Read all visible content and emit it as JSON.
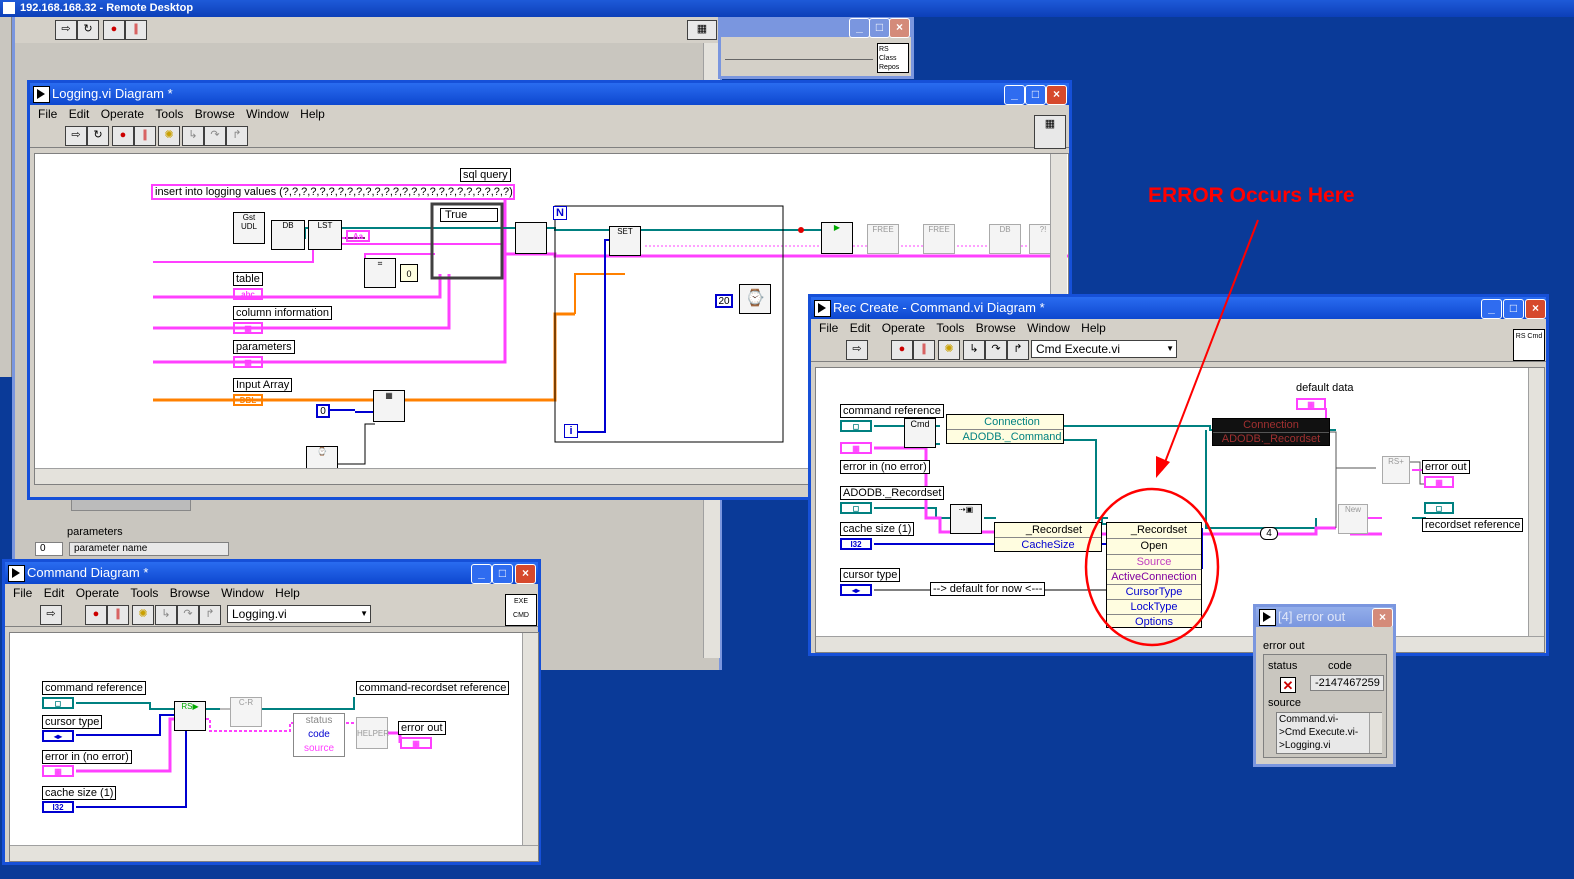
{
  "remote_title": "192.168.168.32 - Remote Desktop",
  "icons": {
    "vi": "labview-vi-icon",
    "minimize": "minimize-icon",
    "maximize": "maximize-icon",
    "close": "close-icon"
  },
  "colors": {
    "desktop": "#0a3a98",
    "titlebar": "#0d47cf",
    "wire_pink": "#ff40ff",
    "wire_blue": "#0000d0",
    "wire_orange": "#ff8000",
    "wire_teal": "#008080",
    "annotation": "#ff0000"
  },
  "menu": [
    "File",
    "Edit",
    "Operate",
    "Tools",
    "Browse",
    "Window",
    "Help"
  ],
  "bg_window": {
    "label1": "RS Class Repos"
  },
  "logging": {
    "title": "Logging.vi Diagram *",
    "sql_label": "sql query",
    "sql_value": "insert into logging values (?,?,?,?,?,?,?,?,?,?,?,?,?,?,?,?,?,?,?,?,?,?,?,?,?)",
    "case_value": "True",
    "table": "table",
    "column_info": "column information",
    "parameters": "parameters",
    "input_array": "Input Array",
    "const_zero": "0",
    "const_twenty": "20",
    "loop_n": "N",
    "loop_i": "i",
    "gst_udl": "Gst UDL",
    "lst": "LST",
    "abc": "abc",
    "dbl": "DBL",
    "db": "DB"
  },
  "behind_panel": {
    "parameters": "parameters",
    "parameter_name": "parameter name",
    "index": "0"
  },
  "command": {
    "title": "Command Diagram *",
    "vi_select": "Logging.vi",
    "cmd_ref": "command reference",
    "cursor_type": "cursor type",
    "error_in": "error in (no error)",
    "cache_size": "cache size (1)",
    "recordset_ref": "command-recordset reference",
    "error_out": "error out",
    "status": "status",
    "code": "code",
    "source": "source",
    "helper": "HELPER",
    "i32": "I32",
    "exe": "EXE",
    "cmd": "CMD"
  },
  "rec": {
    "title": "Rec Create - Command.vi Diagram *",
    "vi_select": "Cmd Execute.vi",
    "cmd_ref": "command reference",
    "error_in": "error in (no error)",
    "adodb_recordset": "ADODB._Recordset",
    "cache_size": "cache size (1)",
    "cursor_type": "cursor type",
    "default_comment": "--> default for now <---",
    "connection": "Connection",
    "adodb_command": "ADODB._Command",
    "default_data": "default data",
    "error_out": "error out",
    "recordset_ref": "recordset reference",
    "recordset1": "_Recordset",
    "cachesize": "CacheSize",
    "recordset2": "_Recordset",
    "invoke_items": [
      "Open",
      "Source",
      "ActiveConnection",
      "CursorType",
      "LockType",
      "Options"
    ],
    "const_four": "4",
    "dark_connection": "Connection",
    "dark_recordset": "ADODB._Recordset",
    "i32": "I32",
    "cmd": "Cmd",
    "rs_cmd": "RS Cmd"
  },
  "annotation": "ERROR Occurs Here",
  "error_popup": {
    "title": "[4] error out",
    "header": "error out",
    "status_label": "status",
    "code_label": "code",
    "code_value": "-2147467259",
    "source_label": "source",
    "source_lines": [
      "Command.vi-",
      ">Cmd Execute.vi-",
      ">Logging.vi"
    ]
  }
}
